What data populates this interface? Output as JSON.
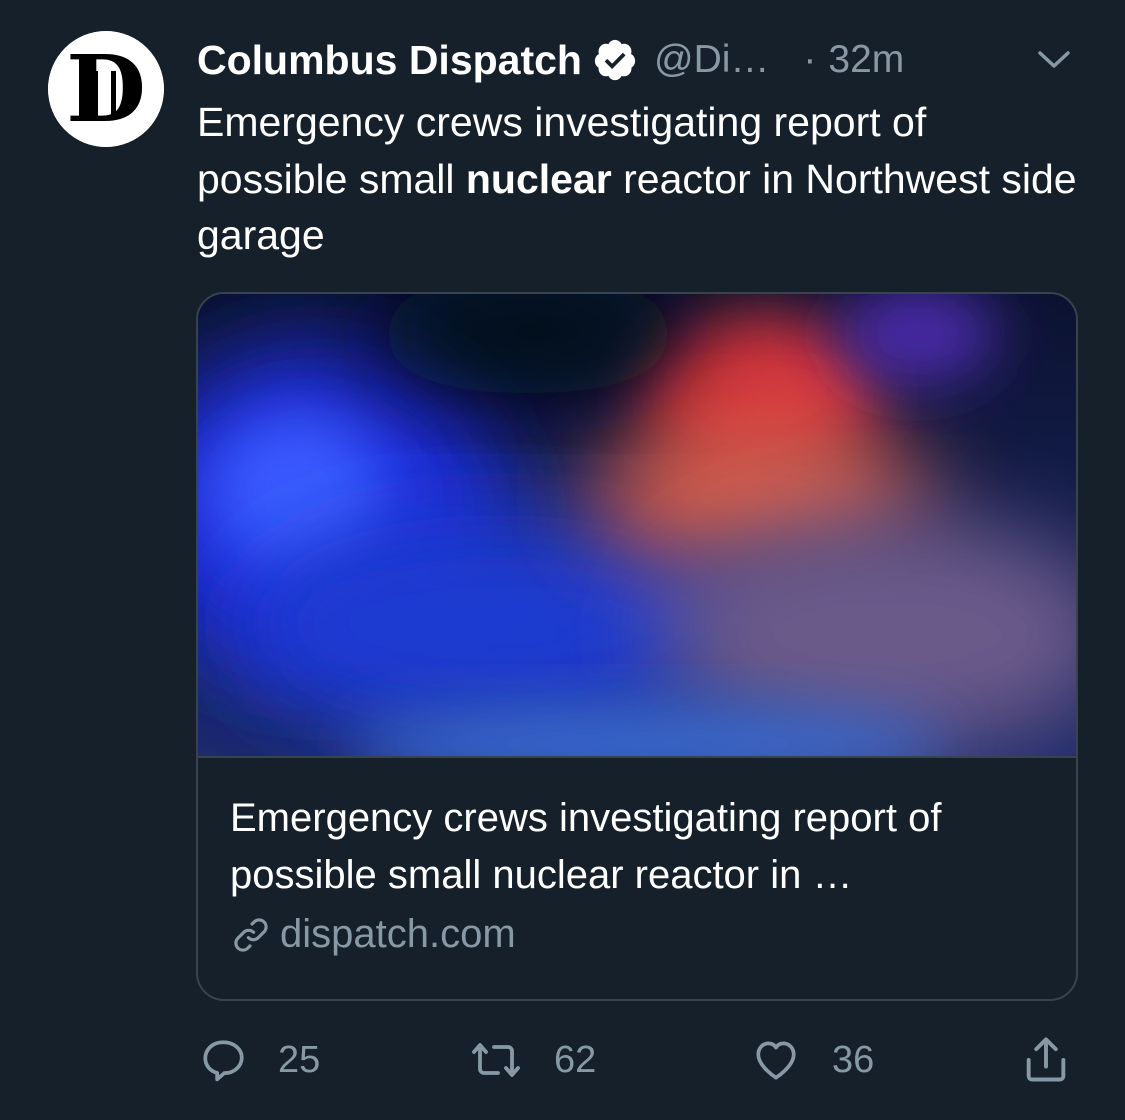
{
  "tweet": {
    "display_name": "Columbus Dispatch",
    "handle": "@Di…",
    "separator": "·",
    "timestamp": "32m",
    "text_before": "Emergency crews investigating report of possible small ",
    "text_bold": "nuclear",
    "text_after": " reactor in Northwest side garage",
    "avatar_letter": "D"
  },
  "card": {
    "title": "Emergency crews investigating report of possible small nuclear reactor in …",
    "domain": "dispatch.com"
  },
  "actions": {
    "replies": "25",
    "retweets": "62",
    "likes": "36"
  },
  "icons": {
    "verified": "verified-badge-icon",
    "caret": "chevron-down-icon",
    "link": "link-icon",
    "reply": "reply-icon",
    "retweet": "retweet-icon",
    "like": "heart-icon",
    "share": "share-icon"
  },
  "colors": {
    "background": "#15202b",
    "secondary_text": "#8899a6",
    "border": "#38444d"
  }
}
